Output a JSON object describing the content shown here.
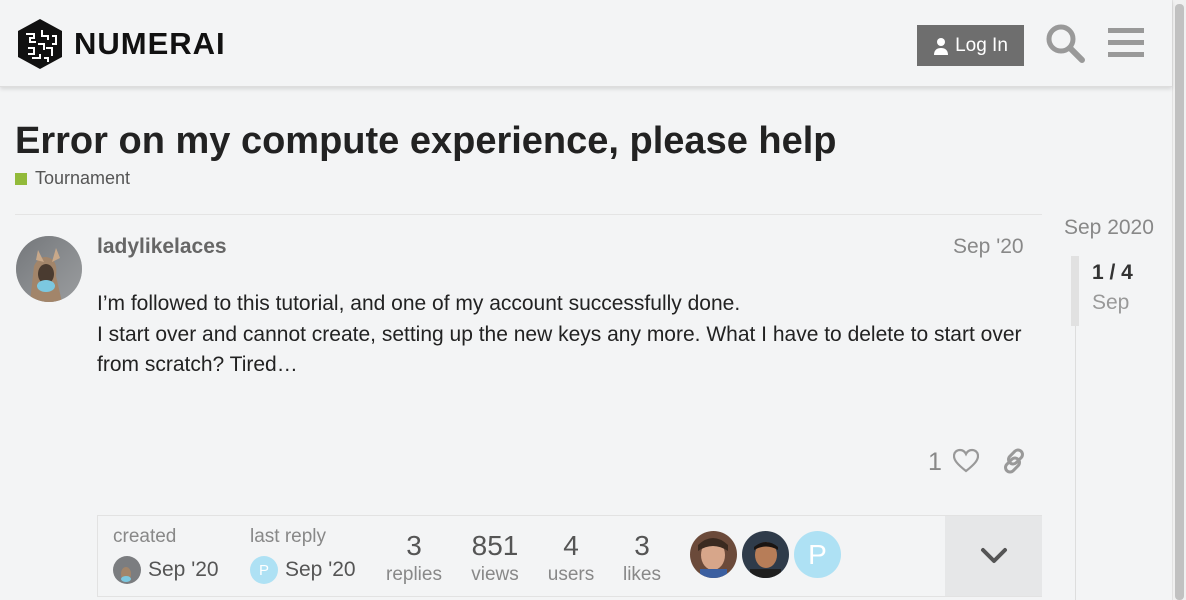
{
  "header": {
    "brand": "NUMERAI",
    "login_label": "Log In",
    "icons": [
      "numerai-logo-icon",
      "user-icon",
      "search-icon",
      "hamburger-menu-icon"
    ]
  },
  "topic": {
    "title": "Error on my compute experience, please help",
    "category": "Tournament",
    "category_color": "#92ba3a"
  },
  "post": {
    "author": "ladylikelaces",
    "date": "Sep '20",
    "body": [
      "I’m followed to this tutorial, and one of my account successfully done.",
      "I start over and cannot create, setting up the new keys any more. What I have to delete to start over from scratch? Tired…"
    ],
    "like_count": "1",
    "icons": [
      "heart-icon",
      "link-icon"
    ]
  },
  "topic_map": {
    "created_label": "created",
    "created_date": "Sep '20",
    "last_reply_label": "last reply",
    "last_reply_date": "Sep '20",
    "last_reply_initial": "P",
    "stats": [
      {
        "value": "3",
        "label": "replies"
      },
      {
        "value": "851",
        "label": "views"
      },
      {
        "value": "4",
        "label": "users"
      },
      {
        "value": "3",
        "label": "likes"
      }
    ],
    "participant_initial": "P",
    "participant_color": "#aee1f4"
  },
  "timeline": {
    "start": "Sep 2020",
    "position": "1 / 4",
    "date": "Sep"
  }
}
